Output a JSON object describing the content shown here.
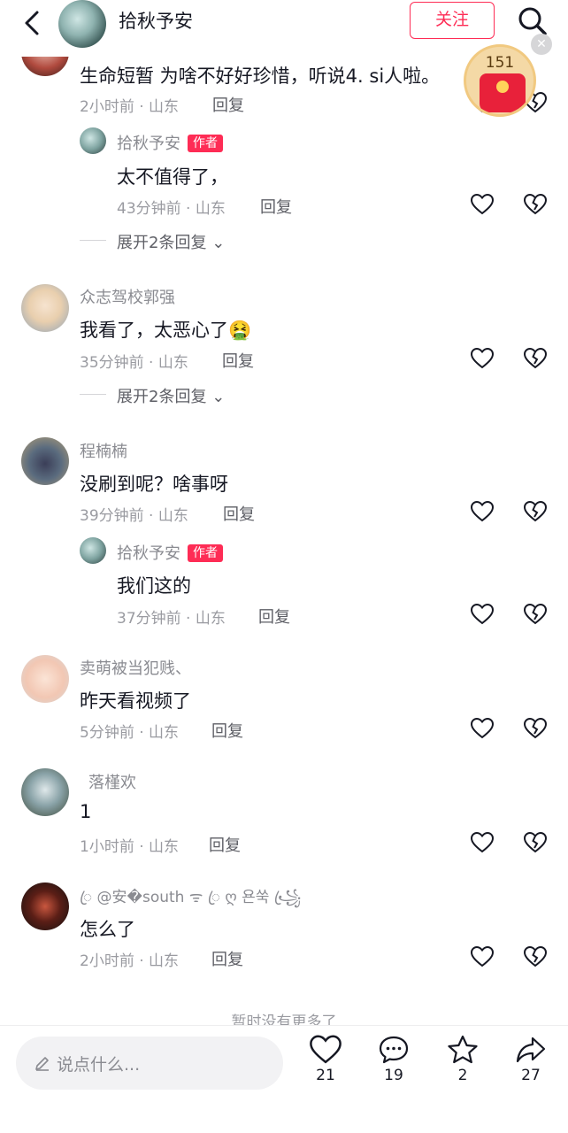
{
  "header": {
    "title": "拾秋予安",
    "follow_label": "关注"
  },
  "red_packet": {
    "count": "151",
    "close": "✕"
  },
  "comments": [
    {
      "text": "生命短暂   为啥不好好珍惜，听说4.  si人啦。",
      "meta": "2小时前 · 山东",
      "reply": "回复",
      "replies": [
        {
          "name": "拾秋予安",
          "tag": "作者",
          "text": "太不值得了，",
          "meta": "43分钟前 · 山东",
          "reply": "回复"
        }
      ],
      "expand": "展开2条回复"
    },
    {
      "name": "众志驾校郭强",
      "text": "我看了，太恶心了🤮",
      "meta": "35分钟前 · 山东",
      "reply": "回复",
      "expand": "展开2条回复"
    },
    {
      "name": "程楠楠",
      "text": "没刷到呢？啥事呀",
      "meta": "39分钟前 · 山东",
      "reply": "回复",
      "replies": [
        {
          "name": "拾秋予安",
          "tag": "作者",
          "text": "我们这的",
          "meta": "37分钟前 · 山东",
          "reply": "回复"
        }
      ]
    },
    {
      "name": "卖萌被当犯贱、",
      "text": "昨天看视频了",
      "meta": "5分钟前 · 山东",
      "reply": "回复"
    },
    {
      "name": "落槿欢",
      "text": "1",
      "meta": "1小时前 · 山东",
      "reply": "回复"
    },
    {
      "name": "ꦿ @安�south ᯤ ꦿ ღ 욘쑥 ꧁ꦿ",
      "text": "怎么了",
      "meta": "2小时前 · 山东",
      "reply": "回复"
    }
  ],
  "no_more": "暂时没有更多了",
  "bottom": {
    "placeholder": "说点什么...",
    "like_count": "21",
    "comment_count": "19",
    "star_count": "2",
    "share_count": "27"
  }
}
